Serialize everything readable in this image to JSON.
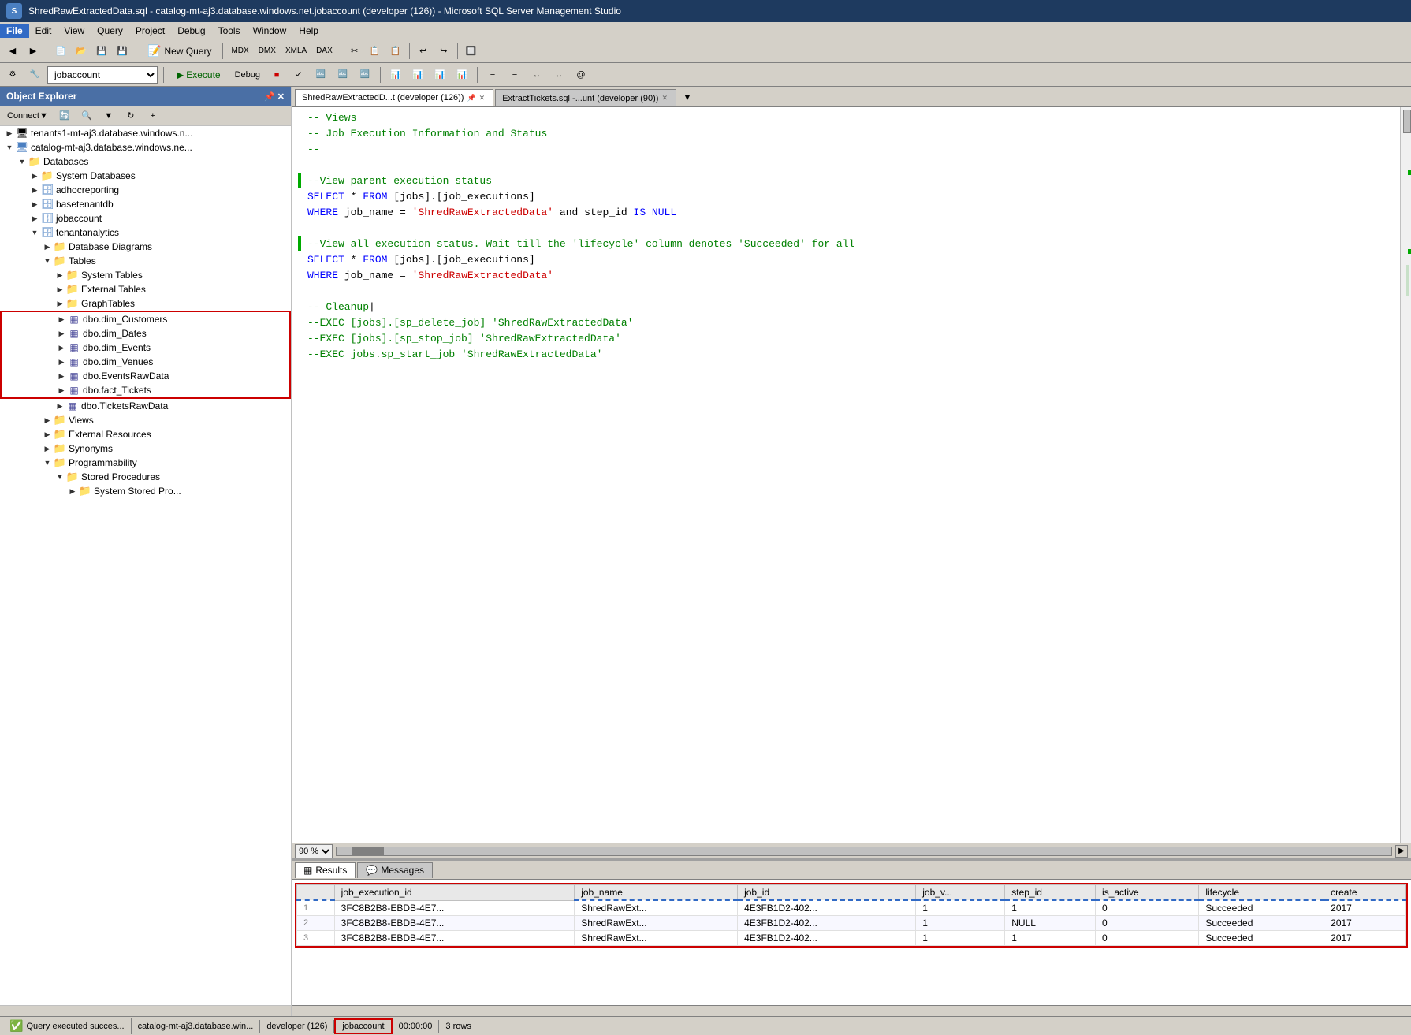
{
  "titleBar": {
    "title": "ShredRawExtractedData.sql - catalog-mt-aj3.database.windows.net.jobaccount (developer (126)) - Microsoft SQL Server Management Studio",
    "icon": "SSMS"
  },
  "menuBar": {
    "items": [
      "File",
      "Edit",
      "View",
      "Query",
      "Project",
      "Debug",
      "Tools",
      "Window",
      "Help"
    ]
  },
  "toolbar": {
    "newQueryLabel": "New Query",
    "database": "jobaccount",
    "executeLabel": "Execute",
    "debugLabel": "Debug"
  },
  "objectExplorer": {
    "title": "Object Explorer",
    "connectLabel": "Connect",
    "tree": [
      {
        "id": "server1",
        "level": 0,
        "label": "tenants1-mt-aj3.database.windows.n...",
        "type": "server",
        "expanded": true
      },
      {
        "id": "server2",
        "level": 0,
        "label": "catalog-mt-aj3.database.windows.ne...",
        "type": "server",
        "expanded": true
      },
      {
        "id": "databases",
        "level": 1,
        "label": "Databases",
        "type": "folder",
        "expanded": true
      },
      {
        "id": "systemdb",
        "level": 2,
        "label": "System Databases",
        "type": "folder",
        "expanded": false
      },
      {
        "id": "adhoc",
        "level": 2,
        "label": "adhocreporting",
        "type": "database",
        "expanded": false
      },
      {
        "id": "basetenant",
        "level": 2,
        "label": "basetenantdb",
        "type": "database",
        "expanded": false
      },
      {
        "id": "jobaccount",
        "level": 2,
        "label": "jobaccount",
        "type": "database",
        "expanded": false
      },
      {
        "id": "tenantanalytics",
        "level": 2,
        "label": "tenantanalytics",
        "type": "database",
        "expanded": true
      },
      {
        "id": "diagrams",
        "level": 3,
        "label": "Database Diagrams",
        "type": "folder",
        "expanded": false
      },
      {
        "id": "tables",
        "level": 3,
        "label": "Tables",
        "type": "folder",
        "expanded": true
      },
      {
        "id": "systables",
        "level": 4,
        "label": "System Tables",
        "type": "folder",
        "expanded": false
      },
      {
        "id": "exttables",
        "level": 4,
        "label": "External Tables",
        "type": "folder",
        "expanded": false
      },
      {
        "id": "graphtables",
        "level": 4,
        "label": "GraphTables",
        "type": "folder",
        "expanded": false
      },
      {
        "id": "dimcustomers",
        "level": 4,
        "label": "dbo.dim_Customers",
        "type": "table",
        "highlighted": true
      },
      {
        "id": "dimdates",
        "level": 4,
        "label": "dbo.dim_Dates",
        "type": "table",
        "highlighted": true
      },
      {
        "id": "dimevents",
        "level": 4,
        "label": "dbo.dim_Events",
        "type": "table",
        "highlighted": true
      },
      {
        "id": "dimvenues",
        "level": 4,
        "label": "dbo.dim_Venues",
        "type": "table",
        "highlighted": true
      },
      {
        "id": "eventsrawdata",
        "level": 4,
        "label": "dbo.EventsRawData",
        "type": "table",
        "highlighted": true
      },
      {
        "id": "facttickets",
        "level": 4,
        "label": "dbo.fact_Tickets",
        "type": "table",
        "highlighted": true
      },
      {
        "id": "ticketsrawdata",
        "level": 4,
        "label": "dbo.TicketsRawData",
        "type": "table"
      },
      {
        "id": "views",
        "level": 3,
        "label": "Views",
        "type": "folder",
        "expanded": false
      },
      {
        "id": "extresources",
        "level": 3,
        "label": "External Resources",
        "type": "folder",
        "expanded": false
      },
      {
        "id": "synonyms",
        "level": 3,
        "label": "Synonyms",
        "type": "folder",
        "expanded": false
      },
      {
        "id": "programmability",
        "level": 3,
        "label": "Programmability",
        "type": "folder",
        "expanded": true
      },
      {
        "id": "storedprocs",
        "level": 4,
        "label": "Stored Procedures",
        "type": "folder",
        "expanded": true
      },
      {
        "id": "sysstoredprocs",
        "level": 5,
        "label": "System Stored Pro...",
        "type": "folder",
        "expanded": false
      }
    ]
  },
  "tabs": [
    {
      "id": "tab1",
      "label": "ShredRawExtractedD...t (developer (126))",
      "active": true,
      "pinned": false
    },
    {
      "id": "tab2",
      "label": "ExtractTickets.sql -...unt (developer (90))",
      "active": false,
      "pinned": false
    }
  ],
  "codeEditor": {
    "zoomLevel": "90 %",
    "lines": [
      {
        "text": "-- Views",
        "type": "comment"
      },
      {
        "text": "-- Job Execution Information and Status",
        "type": "comment"
      },
      {
        "text": "--",
        "type": "comment"
      },
      {
        "text": "",
        "type": "blank"
      },
      {
        "text": "--View parent execution status",
        "type": "comment",
        "hasIndicator": true
      },
      {
        "text": "SELECT * FROM [jobs].[job_executions]",
        "type": "sql_keyword_select"
      },
      {
        "text": "WHERE job_name = 'ShredRawExtractedData' and step_id IS NULL",
        "type": "sql_where"
      },
      {
        "text": "",
        "type": "blank"
      },
      {
        "text": "--View all execution status. Wait till the 'lifecycle' column denotes 'Succeeded' for all",
        "type": "comment",
        "hasIndicator": true
      },
      {
        "text": "SELECT * FROM [jobs].[job_executions]",
        "type": "sql_keyword_select"
      },
      {
        "text": "WHERE job_name = 'ShredRawExtractedData'",
        "type": "sql_where"
      },
      {
        "text": "",
        "type": "blank"
      },
      {
        "text": "-- Cleanup",
        "type": "comment"
      },
      {
        "text": "--EXEC [jobs].[sp_delete_job] 'ShredRawExtractedData'",
        "type": "comment"
      },
      {
        "text": "--EXEC [jobs].[sp_stop_job] 'ShredRawExtractedData'",
        "type": "comment"
      },
      {
        "text": "--EXEC jobs.sp_start_job 'ShredRawExtractedData'",
        "type": "comment"
      }
    ]
  },
  "results": {
    "tabs": [
      "Results",
      "Messages"
    ],
    "activeTab": "Results",
    "columns": [
      "job_execution_id",
      "job_name",
      "job_id",
      "job_v...",
      "step_id",
      "is_active",
      "lifecycle",
      "create"
    ],
    "rows": [
      {
        "rowNum": "1",
        "job_execution_id": "3FC8B2B8-EBDB-4E7...",
        "job_name": "ShredRawExt...",
        "job_id": "4E3FB1D2-402...",
        "job_v": "1",
        "step_id": "1",
        "is_active": "0",
        "lifecycle": "Succeeded",
        "create": "2017"
      },
      {
        "rowNum": "2",
        "job_execution_id": "3FC8B2B8-EBDB-4E7...",
        "job_name": "ShredRawExt...",
        "job_id": "4E3FB1D2-402...",
        "job_v": "1",
        "step_id": "NULL",
        "is_active": "0",
        "lifecycle": "Succeeded",
        "create": "2017"
      },
      {
        "rowNum": "3",
        "job_execution_id": "3FC8B2B8-EBDB-4E7...",
        "job_name": "ShredRawExt...",
        "job_id": "4E3FB1D2-402...",
        "job_v": "1",
        "step_id": "1",
        "is_active": "0",
        "lifecycle": "Succeeded",
        "create": "2017"
      }
    ]
  },
  "statusBar": {
    "message": "Query executed succes...",
    "server": "catalog-mt-aj3.database.win...",
    "user": "developer (126)",
    "database": "jobaccount",
    "time": "00:00:00",
    "rows": "3 rows"
  }
}
